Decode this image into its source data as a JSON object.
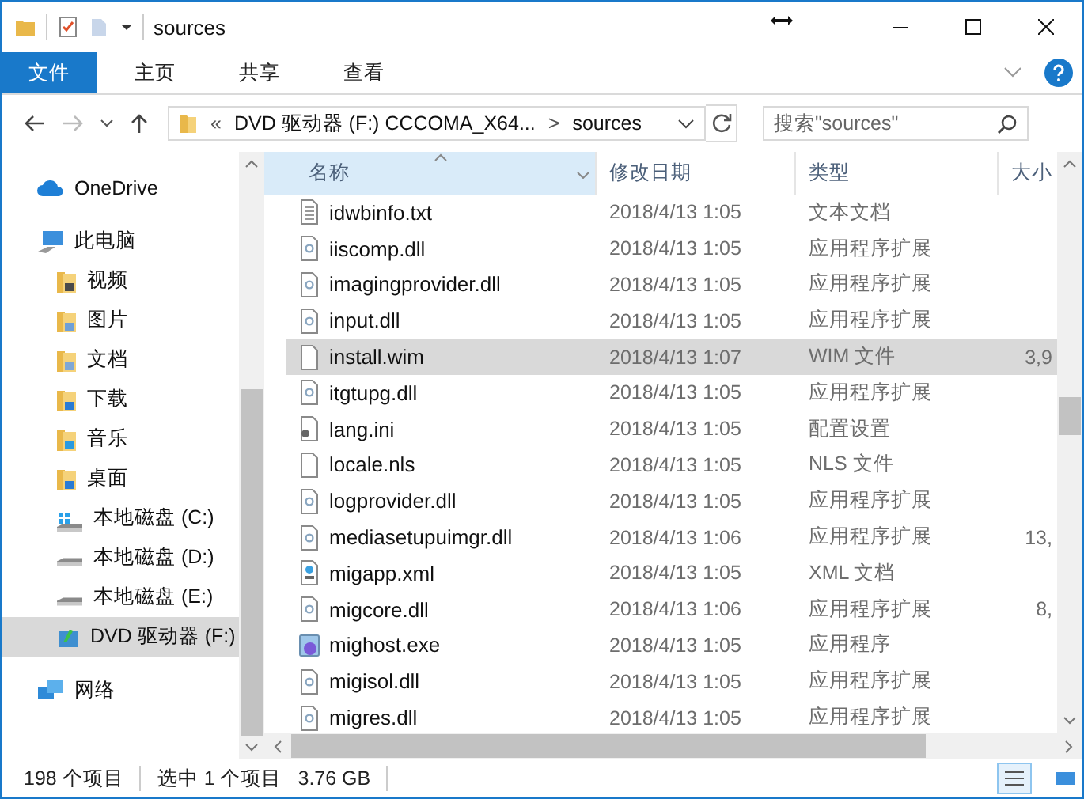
{
  "window": {
    "title": "sources"
  },
  "ribbon_tabs": [
    {
      "label": "文件",
      "selected": true
    },
    {
      "label": "主页",
      "selected": false
    },
    {
      "label": "共享",
      "selected": false
    },
    {
      "label": "查看",
      "selected": false
    }
  ],
  "nav": {
    "forward_disabled": true
  },
  "address": {
    "overflow": "«",
    "segments": [
      "DVD 驱动器 (F:) CCCOMA_X64...",
      "sources"
    ],
    "separator": ">"
  },
  "search": {
    "placeholder": "搜索\"sources\""
  },
  "sidebar": {
    "items": [
      {
        "label": "OneDrive",
        "kind": "cloud",
        "selected": false
      },
      {
        "label": "此电脑",
        "kind": "pc",
        "selected": false,
        "children": [
          {
            "label": "视频",
            "kind": "videos",
            "selected": false
          },
          {
            "label": "图片",
            "kind": "pictures",
            "selected": false
          },
          {
            "label": "文档",
            "kind": "documents",
            "selected": false
          },
          {
            "label": "下载",
            "kind": "downloads",
            "selected": false
          },
          {
            "label": "音乐",
            "kind": "music",
            "selected": false
          },
          {
            "label": "桌面",
            "kind": "desktop",
            "selected": false
          },
          {
            "label": "本地磁盘 (C:)",
            "kind": "system-drive",
            "selected": false
          },
          {
            "label": "本地磁盘 (D:)",
            "kind": "drive",
            "selected": false
          },
          {
            "label": "本地磁盘 (E:)",
            "kind": "drive",
            "selected": false
          },
          {
            "label": "DVD 驱动器 (F:)",
            "kind": "dvd",
            "selected": true
          }
        ]
      },
      {
        "label": "网络",
        "kind": "network",
        "selected": false
      }
    ]
  },
  "table": {
    "columns": [
      "名称",
      "修改日期",
      "类型",
      "大小"
    ],
    "rows": [
      {
        "name": "idwbinfo.txt",
        "kind": "text",
        "date": "2018/4/13 1:05",
        "type": "文本文档",
        "selected": false
      },
      {
        "name": "iiscomp.dll",
        "kind": "dll",
        "date": "2018/4/13 1:05",
        "type": "应用程序扩展",
        "selected": false
      },
      {
        "name": "imagingprovider.dll",
        "kind": "dll",
        "date": "2018/4/13 1:05",
        "type": "应用程序扩展",
        "selected": false
      },
      {
        "name": "input.dll",
        "kind": "dll",
        "date": "2018/4/13 1:05",
        "type": "应用程序扩展",
        "selected": false
      },
      {
        "name": "install.wim",
        "kind": "blank",
        "date": "2018/4/13 1:07",
        "type": "WIM 文件",
        "size": "3,9",
        "selected": true
      },
      {
        "name": "itgtupg.dll",
        "kind": "dll",
        "date": "2018/4/13 1:05",
        "type": "应用程序扩展",
        "selected": false
      },
      {
        "name": "lang.ini",
        "kind": "ini",
        "date": "2018/4/13 1:05",
        "type": "配置设置",
        "selected": false
      },
      {
        "name": "locale.nls",
        "kind": "blank",
        "date": "2018/4/13 1:05",
        "type": "NLS 文件",
        "selected": false
      },
      {
        "name": "logprovider.dll",
        "kind": "dll",
        "date": "2018/4/13 1:05",
        "type": "应用程序扩展",
        "selected": false
      },
      {
        "name": "mediasetupuimgr.dll",
        "kind": "dll",
        "date": "2018/4/13 1:06",
        "type": "应用程序扩展",
        "size": "13,",
        "selected": false
      },
      {
        "name": "migapp.xml",
        "kind": "xml",
        "date": "2018/4/13 1:05",
        "type": "XML 文档",
        "selected": false
      },
      {
        "name": "migcore.dll",
        "kind": "dll",
        "date": "2018/4/13 1:06",
        "type": "应用程序扩展",
        "size": "8,",
        "selected": false
      },
      {
        "name": "mighost.exe",
        "kind": "exe",
        "date": "2018/4/13 1:05",
        "type": "应用程序",
        "selected": false
      },
      {
        "name": "migisol.dll",
        "kind": "dll",
        "date": "2018/4/13 1:05",
        "type": "应用程序扩展",
        "selected": false
      },
      {
        "name": "migres.dll",
        "kind": "dll",
        "date": "2018/4/13 1:05",
        "type": "应用程序扩展",
        "selected": false
      }
    ]
  },
  "status_bar": {
    "count": "198 个项目",
    "selection": "选中 1 个项目",
    "size": "3.76 GB"
  }
}
